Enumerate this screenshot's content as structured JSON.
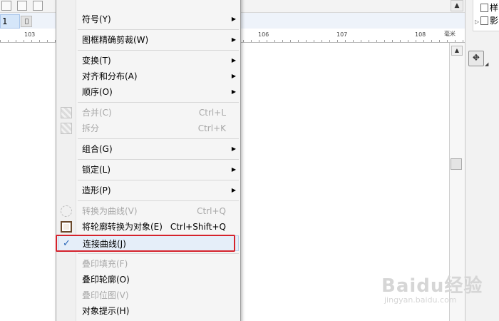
{
  "toolbar": {
    "scroll_up_glyph": "▲"
  },
  "page_indicator": {
    "number": "1"
  },
  "ruler": {
    "labels": [
      "103",
      "106",
      "107",
      "108"
    ],
    "unit": "毫米"
  },
  "right_panel": {
    "rows": [
      {
        "expander": "",
        "label": "样"
      },
      {
        "expander": "▷",
        "label": "影"
      }
    ],
    "tool_icon": "⛖"
  },
  "vertical_scrollbar": {
    "up_glyph": "▲"
  },
  "context_menu": {
    "items": [
      {
        "id": "symbol",
        "label": "符号(Y)",
        "shortcut": "",
        "submenu": true,
        "enabled": true
      },
      {
        "id": "powerclip",
        "label": "图框精确剪裁(W)",
        "shortcut": "",
        "submenu": true,
        "enabled": true
      },
      {
        "id": "transform",
        "label": "变换(T)",
        "shortcut": "",
        "submenu": true,
        "enabled": true
      },
      {
        "id": "align",
        "label": "对齐和分布(A)",
        "shortcut": "",
        "submenu": true,
        "enabled": true
      },
      {
        "id": "order",
        "label": "顺序(O)",
        "shortcut": "",
        "submenu": true,
        "enabled": true
      },
      {
        "id": "combine",
        "label": "合并(C)",
        "shortcut": "Ctrl+L",
        "submenu": false,
        "enabled": false
      },
      {
        "id": "break-apart",
        "label": "拆分",
        "shortcut": "Ctrl+K",
        "submenu": false,
        "enabled": false
      },
      {
        "id": "group",
        "label": "组合(G)",
        "shortcut": "",
        "submenu": true,
        "enabled": true
      },
      {
        "id": "lock",
        "label": "锁定(L)",
        "shortcut": "",
        "submenu": true,
        "enabled": true
      },
      {
        "id": "shaping",
        "label": "造形(P)",
        "shortcut": "",
        "submenu": true,
        "enabled": true
      },
      {
        "id": "convert-to-curves",
        "label": "转换为曲线(V)",
        "shortcut": "Ctrl+Q",
        "submenu": false,
        "enabled": false
      },
      {
        "id": "outline-to-object",
        "label": "将轮廓转换为对象(E)",
        "shortcut": "Ctrl+Shift+Q",
        "submenu": false,
        "enabled": true
      },
      {
        "id": "join-curves",
        "label": "连接曲线(J)",
        "shortcut": "",
        "submenu": false,
        "enabled": true,
        "checked": true
      },
      {
        "id": "overprint-fill",
        "label": "叠印填充(F)",
        "shortcut": "",
        "submenu": false,
        "enabled": false
      },
      {
        "id": "overprint-outline",
        "label": "叠印轮廓(O)",
        "shortcut": "",
        "submenu": false,
        "enabled": true
      },
      {
        "id": "overprint-bitmap",
        "label": "叠印位图(V)",
        "shortcut": "",
        "submenu": false,
        "enabled": false
      },
      {
        "id": "object-hints",
        "label": "对象提示(H)",
        "shortcut": "",
        "submenu": false,
        "enabled": true
      }
    ],
    "submenu_glyph": "▶",
    "check_glyph": "✓",
    "highlight_color": "#e5eef9",
    "annotation_color": "#d5222c"
  },
  "watermark": {
    "main": "Baidu经验",
    "url": "jingyan.baidu.com"
  }
}
